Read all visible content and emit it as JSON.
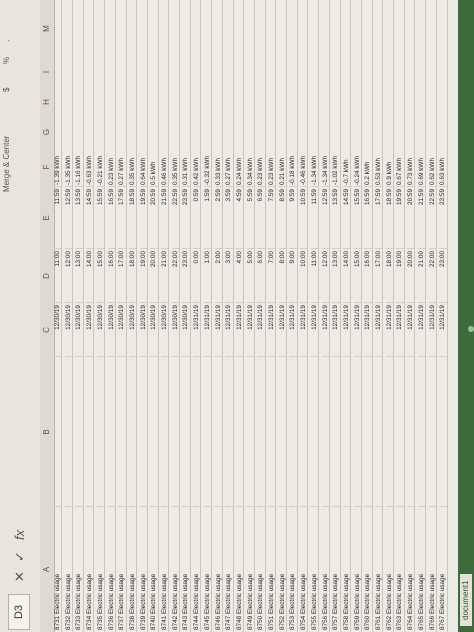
{
  "formula_bar": {
    "name_box": "D3",
    "cancel_icon": "✕",
    "confirm_icon": "✓",
    "fx_label": "fx",
    "ribbon_merge": "Merge & Center",
    "ribbon_currency": "$",
    "ribbon_percent": "%",
    "ribbon_comma": ","
  },
  "columns": [
    "A",
    "B",
    "C",
    "D",
    "E",
    "F",
    "G",
    "H",
    "I",
    "M"
  ],
  "rows": [
    {
      "a": "8731 Electric usage",
      "c": "12/30/19",
      "d": "11:00",
      "e": "11:59",
      "f": "-1.39 kWh"
    },
    {
      "a": "8732 Electric usage",
      "c": "12/30/19",
      "d": "12:00",
      "e": "12:59",
      "f": "-1.35 kWh"
    },
    {
      "a": "8733 Electric usage",
      "c": "12/30/19",
      "d": "13:00",
      "e": "13:59",
      "f": "-1.16 kWh"
    },
    {
      "a": "8734 Electric usage",
      "c": "12/30/19",
      "d": "14:00",
      "e": "14:59",
      "f": "-0.63 kWh"
    },
    {
      "a": "8735 Electric usage",
      "c": "12/30/19",
      "d": "15:00",
      "e": "15:59",
      "f": "-0.21 kWh"
    },
    {
      "a": "8736 Electric usage",
      "c": "12/30/19",
      "d": "16:00",
      "e": "16:59",
      "f": "0.23 kWh"
    },
    {
      "a": "8737 Electric usage",
      "c": "12/30/19",
      "d": "17:00",
      "e": "17:59",
      "f": "0.27 kWh"
    },
    {
      "a": "8738 Electric usage",
      "c": "12/30/19",
      "d": "18:00",
      "e": "18:59",
      "f": "0.35 kWh"
    },
    {
      "a": "8739 Electric usage",
      "c": "12/30/19",
      "d": "19:00",
      "e": "19:59",
      "f": "0.64 kWh"
    },
    {
      "a": "8740 Electric usage",
      "c": "12/30/19",
      "d": "20:00",
      "e": "20:59",
      "f": "0.5 kWh"
    },
    {
      "a": "8741 Electric usage",
      "c": "12/30/19",
      "d": "21:00",
      "e": "21:59",
      "f": "0.46 kWh"
    },
    {
      "a": "8742 Electric usage",
      "c": "12/30/19",
      "d": "22:00",
      "e": "22:59",
      "f": "0.35 kWh"
    },
    {
      "a": "8743 Electric usage",
      "c": "12/30/19",
      "d": "23:00",
      "e": "23:59",
      "f": "0.31 kWh"
    },
    {
      "a": "8744 Electric usage",
      "c": "12/31/19",
      "d": "0:00",
      "e": "0:59",
      "f": "0.42 kWh"
    },
    {
      "a": "8745 Electric usage",
      "c": "12/31/19",
      "d": "1:00",
      "e": "1:59",
      "f": "-0.32 kWh"
    },
    {
      "a": "8746 Electric usage",
      "c": "12/31/19",
      "d": "2:00",
      "e": "2:59",
      "f": "0.33 kWh"
    },
    {
      "a": "8747 Electric usage",
      "c": "12/31/19",
      "d": "3:00",
      "e": "3:59",
      "f": "0.27 kWh"
    },
    {
      "a": "8748 Electric usage",
      "c": "12/31/19",
      "d": "4:00",
      "e": "4:59",
      "f": "0.24 kWh"
    },
    {
      "a": "8749 Electric usage",
      "c": "12/31/19",
      "d": "5:00",
      "e": "5:59",
      "f": "0.34 kWh"
    },
    {
      "a": "8750 Electric usage",
      "c": "12/31/19",
      "d": "6:00",
      "e": "6:59",
      "f": "0.23 kWh"
    },
    {
      "a": "8751 Electric usage",
      "c": "12/31/19",
      "d": "7:00",
      "e": "7:59",
      "f": "0.23 kWh"
    },
    {
      "a": "8752 Electric usage",
      "c": "12/31/19",
      "d": "8:00",
      "e": "8:59",
      "f": "0.21 kWh"
    },
    {
      "a": "8753 Electric usage",
      "c": "12/31/19",
      "d": "9:00",
      "e": "9:59",
      "f": "-0.18 kWh"
    },
    {
      "a": "8754 Electric usage",
      "c": "12/31/19",
      "d": "10:00",
      "e": "10:59",
      "f": "-0.46 kWh"
    },
    {
      "a": "8755 Electric usage",
      "c": "12/31/19",
      "d": "11:00",
      "e": "11:59",
      "f": "-1.34 kWh"
    },
    {
      "a": "8756 Electric usage",
      "c": "12/31/19",
      "d": "12:00",
      "e": "12:59",
      "f": "-1.34 kWh"
    },
    {
      "a": "8757 Electric usage",
      "c": "12/31/19",
      "d": "13:00",
      "e": "13:59",
      "f": "-1.02 kWh"
    },
    {
      "a": "8758 Electric usage",
      "c": "12/31/19",
      "d": "14:00",
      "e": "14:59",
      "f": "-0.7 kWh"
    },
    {
      "a": "8759 Electric usage",
      "c": "12/31/19",
      "d": "15:00",
      "e": "15:59",
      "f": "-0.24 kWh"
    },
    {
      "a": "8760 Electric usage",
      "c": "12/31/19",
      "d": "16:00",
      "e": "16:59",
      "f": "0.2 kWh"
    },
    {
      "a": "8761 Electric usage",
      "c": "12/31/19",
      "d": "17:00",
      "e": "17:59",
      "f": "0.53 kWh"
    },
    {
      "a": "8762 Electric usage",
      "c": "12/31/19",
      "d": "18:00",
      "e": "18:59",
      "f": "0.9 kWh"
    },
    {
      "a": "8763 Electric usage",
      "c": "12/31/19",
      "d": "19:00",
      "e": "19:59",
      "f": "0.67 kWh"
    },
    {
      "a": "8764 Electric usage",
      "c": "12/31/19",
      "d": "20:00",
      "e": "20:59",
      "f": "0.73 kWh"
    },
    {
      "a": "8765 Electric usage",
      "c": "12/31/19",
      "d": "21:00",
      "e": "21:59",
      "f": "0.69 kWh"
    },
    {
      "a": "8766 Electric usage",
      "c": "12/31/19",
      "d": "22:00",
      "e": "22:59",
      "f": "0.62 kWh"
    },
    {
      "a": "8767 Electric usage",
      "c": "12/31/19",
      "d": "23:00",
      "e": "23:59",
      "f": "0.63 kWh"
    }
  ],
  "sheet_tab": "document1",
  "status_text": "READY"
}
